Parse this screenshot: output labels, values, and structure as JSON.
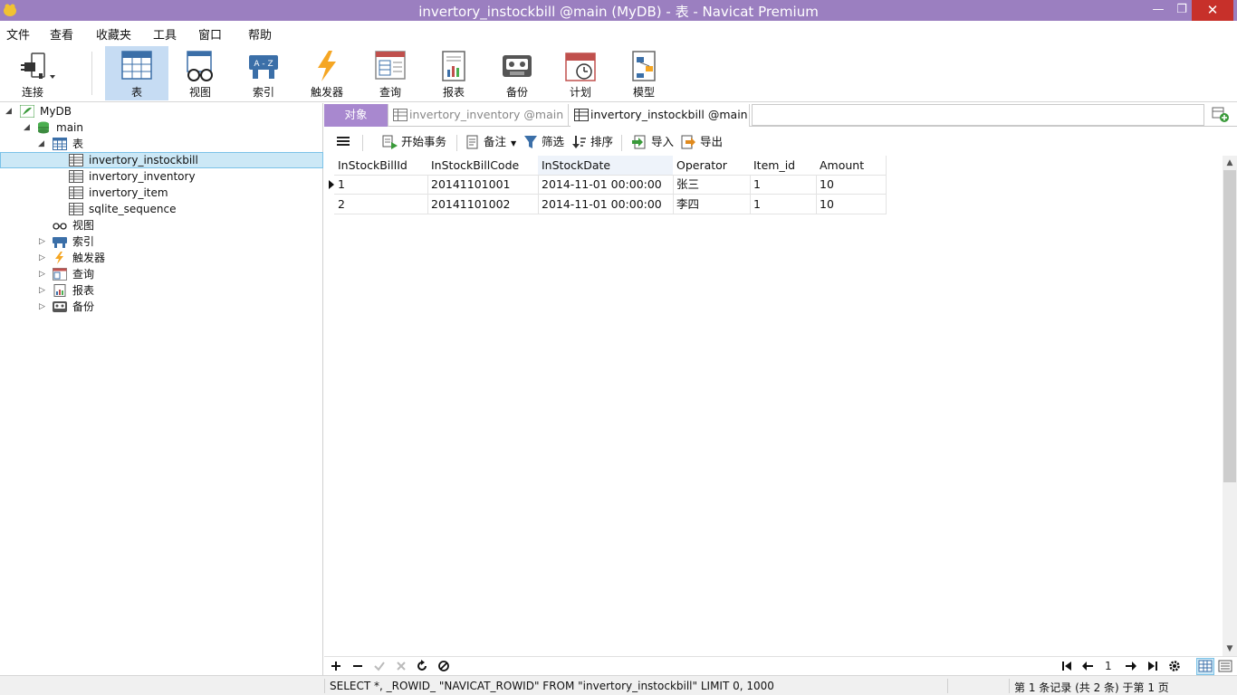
{
  "window": {
    "title": "invertory_instockbill @main (MyDB) - 表 - Navicat Premium",
    "minimize": "—",
    "maximize": "❐",
    "close": "✕"
  },
  "menu": [
    "文件",
    "查看",
    "收藏夹",
    "工具",
    "窗口",
    "帮助"
  ],
  "toolbar": [
    {
      "id": "connect",
      "label": "连接",
      "icon": "plug-icon"
    },
    {
      "id": "table",
      "label": "表",
      "icon": "table-icon",
      "active": true
    },
    {
      "id": "view",
      "label": "视图",
      "icon": "glasses-icon"
    },
    {
      "id": "index",
      "label": "索引",
      "icon": "index-icon"
    },
    {
      "id": "trigger",
      "label": "触发器",
      "icon": "lightning-icon"
    },
    {
      "id": "query",
      "label": "查询",
      "icon": "query-icon"
    },
    {
      "id": "report",
      "label": "报表",
      "icon": "report-icon"
    },
    {
      "id": "backup",
      "label": "备份",
      "icon": "backup-icon"
    },
    {
      "id": "schedule",
      "label": "计划",
      "icon": "calendar-icon"
    },
    {
      "id": "model",
      "label": "模型",
      "icon": "model-icon"
    }
  ],
  "tree": {
    "db": "MyDB",
    "schema": "main",
    "tables_group": "表",
    "tables": [
      "invertory_instockbill",
      "invertory_inventory",
      "invertory_item",
      "sqlite_sequence"
    ],
    "selected_table": "invertory_instockbill",
    "groups": [
      "视图",
      "索引",
      "触发器",
      "查询",
      "报表",
      "备份"
    ]
  },
  "tabs": {
    "objects": "对象",
    "tab1": "invertory_inventory @main (...",
    "tab2": "invertory_instockbill @main ..."
  },
  "table_toolbar": {
    "begin_tx": "开始事务",
    "memo": "备注",
    "filter": "筛选",
    "sort": "排序",
    "import": "导入",
    "export": "导出"
  },
  "grid": {
    "columns": [
      "InStockBillId",
      "InStockBillCode",
      "InStockDate",
      "Operator",
      "Item_id",
      "Amount"
    ],
    "rows": [
      [
        "1",
        "20141101001",
        "2014-11-01 00:00:00",
        "张三",
        "1",
        "10"
      ],
      [
        "2",
        "20141101002",
        "2014-11-01 00:00:00",
        "李四",
        "1",
        "10"
      ]
    ]
  },
  "nav": {
    "page": "1"
  },
  "status": {
    "sql": "SELECT *, _ROWID_ \"NAVICAT_ROWID\" FROM \"invertory_instockbill\" LIMIT 0, 1000",
    "records": "第 1 条记录 (共 2 条) 于第 1 页"
  },
  "colors": {
    "titlebar": "#9b7fc0",
    "tab_objects": "#a888cf",
    "active_tool": "#c6dcf3",
    "selection": "#cce8f6",
    "close": "#c7302a"
  }
}
